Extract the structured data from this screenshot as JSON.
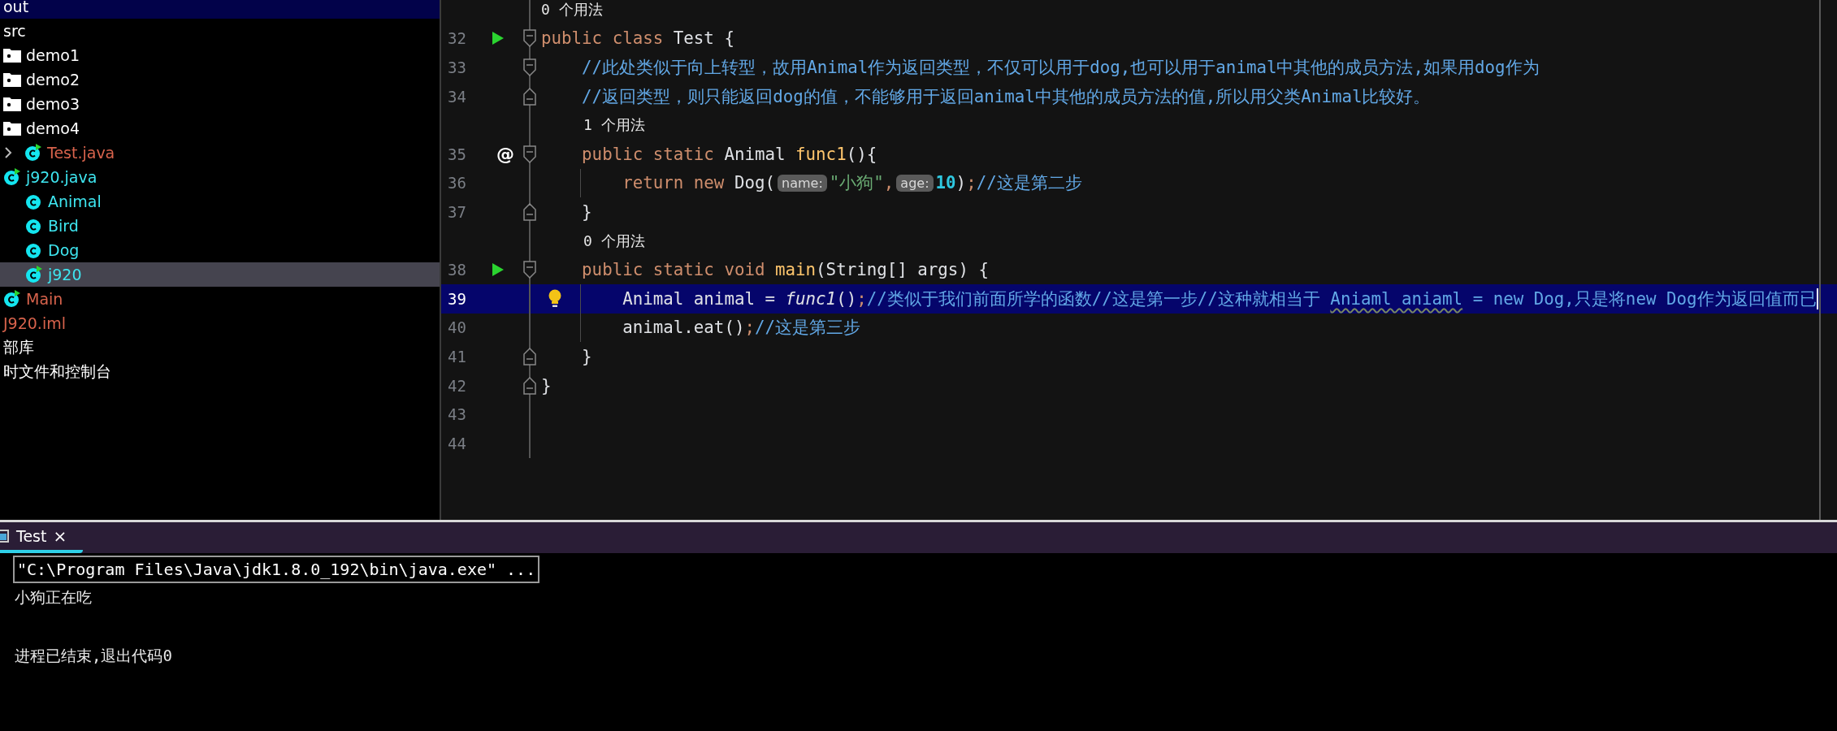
{
  "project_tree": [
    {
      "label": "out",
      "kind": "plain",
      "selected": false,
      "current": true,
      "color": "#ffffff"
    },
    {
      "label": "src",
      "kind": "plain",
      "selected": false,
      "current": false,
      "color": "#ffffff"
    },
    {
      "label": "demo1",
      "kind": "folder",
      "selected": false,
      "current": false,
      "color": "#ffffff"
    },
    {
      "label": "demo2",
      "kind": "folder",
      "selected": false,
      "current": false,
      "color": "#ffffff"
    },
    {
      "label": "demo3",
      "kind": "folder",
      "selected": false,
      "current": false,
      "color": "#ffffff"
    },
    {
      "label": "demo4",
      "kind": "folder",
      "selected": false,
      "current": false,
      "color": "#ffffff"
    },
    {
      "label": "Test.java",
      "kind": "class",
      "runnable": true,
      "expanded": false,
      "selected": false,
      "current": false,
      "color": "#d8634c"
    },
    {
      "label": "j920.java",
      "kind": "class",
      "runnable": true,
      "selected": false,
      "current": false,
      "color": "#3ee6f0",
      "children": [
        {
          "label": "Animal",
          "kind": "class",
          "runnable": false,
          "selected": false,
          "current": false,
          "color": "#3ee6f0"
        },
        {
          "label": "Bird",
          "kind": "class",
          "runnable": false,
          "selected": false,
          "current": false,
          "color": "#3ee6f0"
        },
        {
          "label": "Dog",
          "kind": "class",
          "runnable": false,
          "selected": false,
          "current": false,
          "color": "#3ee6f0"
        },
        {
          "label": "j920",
          "kind": "class",
          "runnable": true,
          "selected": true,
          "current": false,
          "color": "#3ee6f0"
        }
      ]
    },
    {
      "label": "Main",
      "kind": "class",
      "runnable": true,
      "selected": false,
      "current": false,
      "color": "#d8634c"
    },
    {
      "label": "J920.iml",
      "kind": "file",
      "selected": false,
      "current": false,
      "color": "#d8634c"
    },
    {
      "label": "部库",
      "kind": "plain",
      "selected": false,
      "current": false,
      "color": "#ffffff"
    },
    {
      "label": "时文件和控制台",
      "kind": "plain",
      "selected": false,
      "current": false,
      "color": "#ffffff"
    }
  ],
  "editor": {
    "lines": [
      {
        "kind": "hint",
        "text": "0 个用法"
      },
      {
        "kind": "code",
        "number": "32",
        "marker": {
          "kind": "run"
        },
        "fold": {
          "kind": "start"
        },
        "current": false,
        "guide": false,
        "tokens": [
          {
            "kind": "keyword",
            "text": "public class "
          },
          {
            "kind": "plain",
            "text": "Test {"
          }
        ]
      },
      {
        "kind": "code",
        "number": "33",
        "fold": {
          "kind": "start"
        },
        "current": false,
        "guide": false,
        "tokens": [
          {
            "kind": "comment",
            "text": "    //此处类似于向上转型，故用Animal作为返回类型，不仅可以用于dog,也可以用于animal中其他的成员方法,如果用dog作为"
          }
        ]
      },
      {
        "kind": "code",
        "number": "34",
        "fold": {
          "kind": "end"
        },
        "current": false,
        "guide": false,
        "tokens": [
          {
            "kind": "comment",
            "text": "    //返回类型，则只能返回dog的值，不能够用于返回animal中其他的成员方法的值,所以用父类Animal比较好。"
          }
        ]
      },
      {
        "kind": "hint",
        "text": "1 个用法"
      },
      {
        "kind": "code",
        "number": "35",
        "marker": {
          "kind": "at",
          "text": "@"
        },
        "fold": {
          "kind": "start"
        },
        "current": false,
        "guide": false,
        "tokens": [
          {
            "kind": "keyword",
            "text": "    public static "
          },
          {
            "kind": "plain",
            "text": "Animal "
          },
          {
            "kind": "method",
            "text": "func1"
          },
          {
            "kind": "plain",
            "text": "(){"
          }
        ]
      },
      {
        "kind": "code",
        "number": "36",
        "current": false,
        "guide": true,
        "tokens": [
          {
            "kind": "keyword",
            "text": "        return new "
          },
          {
            "kind": "plain",
            "text": "Dog("
          },
          {
            "kind": "param",
            "text": "name:"
          },
          {
            "kind": "string",
            "text": "\"小狗\""
          },
          {
            "kind": "keyword",
            "text": ","
          },
          {
            "kind": "param",
            "text": "age:"
          },
          {
            "kind": "number",
            "text": "10"
          },
          {
            "kind": "plain",
            "text": ")"
          },
          {
            "kind": "keyword",
            "text": ";"
          },
          {
            "kind": "comment",
            "text": "//这是第二步"
          }
        ]
      },
      {
        "kind": "code",
        "number": "37",
        "fold": {
          "kind": "end"
        },
        "current": false,
        "guide": false,
        "tokens": [
          {
            "kind": "plain",
            "text": "    }"
          }
        ]
      },
      {
        "kind": "hint",
        "text": "0 个用法"
      },
      {
        "kind": "code",
        "number": "38",
        "marker": {
          "kind": "run"
        },
        "fold": {
          "kind": "start"
        },
        "current": false,
        "guide": false,
        "tokens": [
          {
            "kind": "keyword",
            "text": "    public static void "
          },
          {
            "kind": "method",
            "text": "main"
          },
          {
            "kind": "plain",
            "text": "(String[] args) {"
          }
        ]
      },
      {
        "kind": "code",
        "number": "39",
        "marker": {
          "kind": "bulb"
        },
        "current": true,
        "guide": true,
        "tokens": [
          {
            "kind": "plain",
            "text": "        Animal animal = "
          },
          {
            "kind": "call",
            "text": "func1"
          },
          {
            "kind": "plain",
            "text": "()"
          },
          {
            "kind": "keyword",
            "text": ";"
          },
          {
            "kind": "comment",
            "text": "//类似于我们前面所学的函数//这是第一步//这种就相当于 "
          },
          {
            "kind": "typo",
            "text": "Aniaml aniaml"
          },
          {
            "kind": "comment",
            "text": " = new Dog,只是将new Dog作为返回值而已"
          }
        ]
      },
      {
        "kind": "code",
        "number": "40",
        "current": false,
        "guide": true,
        "tokens": [
          {
            "kind": "plain",
            "text": "        animal.eat()"
          },
          {
            "kind": "keyword",
            "text": ";"
          },
          {
            "kind": "comment",
            "text": "//这是第三步"
          }
        ]
      },
      {
        "kind": "code",
        "number": "41",
        "fold": {
          "kind": "end"
        },
        "current": false,
        "guide": false,
        "tokens": [
          {
            "kind": "plain",
            "text": "    }"
          }
        ]
      },
      {
        "kind": "code",
        "number": "42",
        "fold": {
          "kind": "end"
        },
        "current": false,
        "guide": false,
        "tokens": [
          {
            "kind": "plain",
            "text": "}"
          }
        ]
      },
      {
        "kind": "code",
        "number": "43",
        "current": false,
        "guide": false
      },
      {
        "kind": "code",
        "number": "44",
        "current": false,
        "guide": false
      }
    ]
  },
  "run_panel": {
    "tabs": [
      {
        "label": "Test",
        "close": "×",
        "selected": true
      }
    ],
    "console": [
      {
        "kind": "command",
        "text": "\"C:\\Program Files\\Java\\jdk1.8.0_192\\bin\\java.exe\" ..."
      },
      {
        "kind": "output",
        "text": "小狗正在吃"
      },
      {
        "kind": "blank"
      },
      {
        "kind": "output",
        "text": "进程已结束,退出代码0"
      }
    ]
  }
}
